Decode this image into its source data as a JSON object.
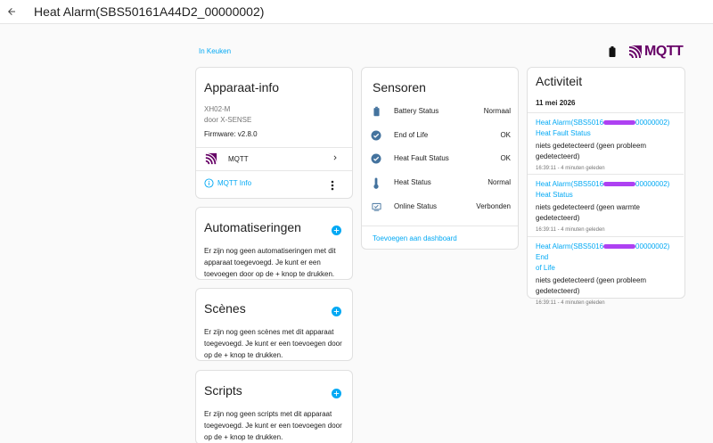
{
  "header": {
    "title": "Heat Alarm(SBS50161A44D2_00000002)"
  },
  "breadcrumb": "In Keuken",
  "brand": {
    "logo_text": "MQTT",
    "color": "#660066"
  },
  "device_info": {
    "title": "Apparaat-info",
    "model": "XH02-M",
    "manufacturer": "door X-SENSE",
    "firmware": "Firmware: v2.8.0",
    "integration": "MQTT",
    "info_link": "MQTT Info"
  },
  "automations": {
    "title": "Automatiseringen",
    "text": "Er zijn nog geen automatiseringen met dit apparaat toegevoegd. Je kunt er een toevoegen door op de + knop te drukken."
  },
  "scenes": {
    "title": "Scènes",
    "text": "Er zijn nog geen scènes met dit apparaat toegevoegd. Je kunt er een toevoegen door op de + knop te drukken."
  },
  "scripts": {
    "title": "Scripts",
    "text": "Er zijn nog geen scripts met dit apparaat toegevoegd. Je kunt er een toevoegen door op de + knop te drukken."
  },
  "sensors": {
    "title": "Sensoren",
    "rows": [
      {
        "icon": "battery-icon",
        "label": "Battery Status",
        "value": "Normaal"
      },
      {
        "icon": "check-circle-icon",
        "label": "End of Life",
        "value": "OK"
      },
      {
        "icon": "check-circle-icon",
        "label": "Heat Fault Status",
        "value": "OK"
      },
      {
        "icon": "thermometer-icon",
        "label": "Heat Status",
        "value": "Normal"
      },
      {
        "icon": "monitor-check-icon",
        "label": "Online Status",
        "value": "Verbonden"
      }
    ],
    "add_link": "Toevoegen aan dashboard"
  },
  "activity": {
    "title": "Activiteit",
    "date": "11 mei 2026",
    "entries": [
      {
        "name_start": "Heat Alarm(SBS5016",
        "name_end": "00000002)",
        "name_line2": "Heat Fault Status",
        "state": "niets gedetecteerd (geen probleem gedetecteerd)",
        "time": "16:39:11 - 4 minuten geleden"
      },
      {
        "name_start": "Heat Alarm(SBS5016",
        "name_end": "00000002)",
        "name_line2": "Heat Status",
        "state": "niets gedetecteerd (geen warmte gedetecteerd)",
        "time": "16:39:11 - 4 minuten geleden"
      },
      {
        "name_start": "Heat Alarm(SBS5016",
        "name_end": "00000002) End",
        "name_line2": "of Life",
        "state": "niets gedetecteerd (geen probleem gedetecteerd)",
        "time": "16:39:11 - 4 minuten geleden"
      }
    ]
  },
  "colors": {
    "accent": "#03a9f4",
    "text": "#212121",
    "muted": "#757575",
    "card_border": "#e0e0e0",
    "icon_blue": "#44739e",
    "redaction": "#a020f0"
  }
}
